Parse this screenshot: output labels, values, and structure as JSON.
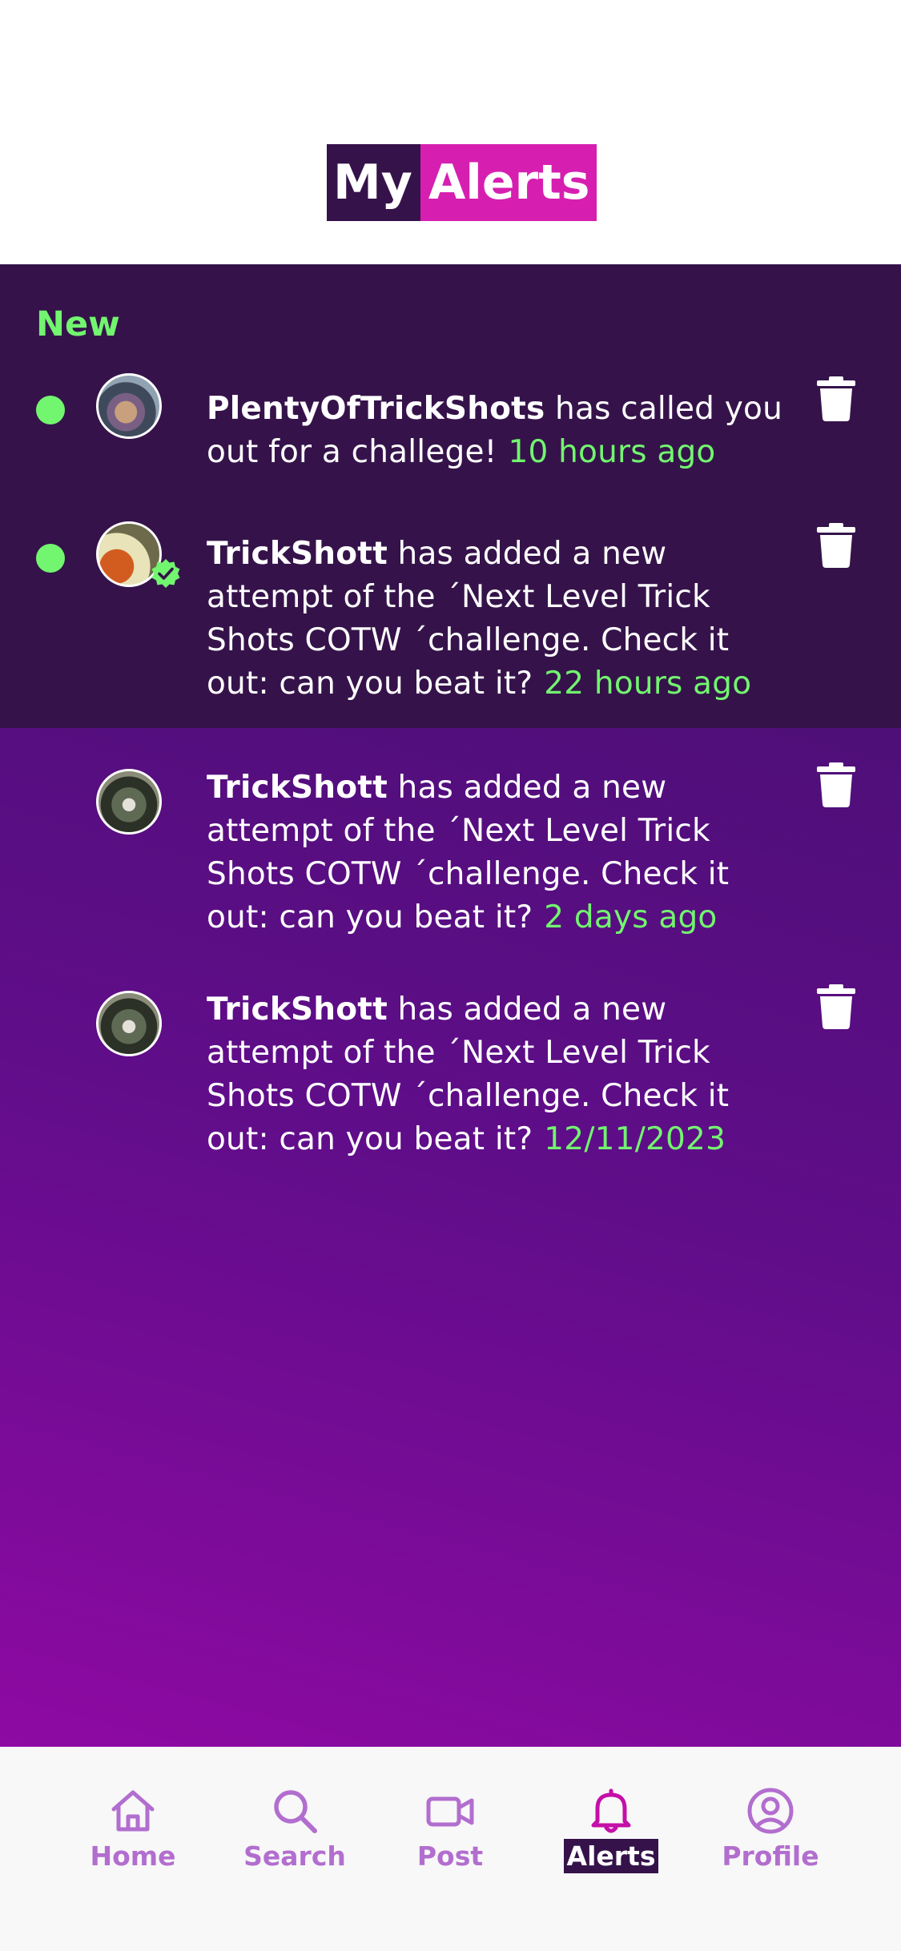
{
  "header": {
    "logo_part1": "My",
    "logo_part2": "Alerts"
  },
  "sections": {
    "new_label": "New"
  },
  "alerts": [
    {
      "user": "PlentyOfTrickShots",
      "message": "has called you out for a challege!",
      "time": "10 hours ago",
      "unread": true,
      "verified": false
    },
    {
      "user": "TrickShott",
      "message": "has added a new attempt of the ´Next Level Trick Shots COTW ´challenge. Check it out: can you beat it?",
      "time": "22 hours ago",
      "unread": true,
      "verified": true
    },
    {
      "user": "TrickShott",
      "message": "has added a new attempt of the ´Next Level Trick Shots COTW ´challenge. Check it out: can you beat it?",
      "time": "2 days ago",
      "unread": false,
      "verified": false
    },
    {
      "user": "TrickShott",
      "message": "has added a new attempt of the ´Next Level Trick Shots COTW ´challenge. Check it out: can you beat it?",
      "time": "12/11/2023",
      "unread": false,
      "verified": false
    }
  ],
  "tabbar": {
    "items": [
      {
        "label": "Home",
        "icon": "home-icon"
      },
      {
        "label": "Search",
        "icon": "search-icon"
      },
      {
        "label": "Post",
        "icon": "video-camera-icon"
      },
      {
        "label": "Alerts",
        "icon": "bell-icon",
        "active": true
      },
      {
        "label": "Profile",
        "icon": "user-circle-icon"
      }
    ]
  },
  "colors": {
    "dark_purple": "#35134a",
    "magenta": "#d61fb0",
    "accent_green": "#72f56f",
    "tab_inactive": "#b26ecf",
    "tab_active_icon": "#c40fa8"
  }
}
